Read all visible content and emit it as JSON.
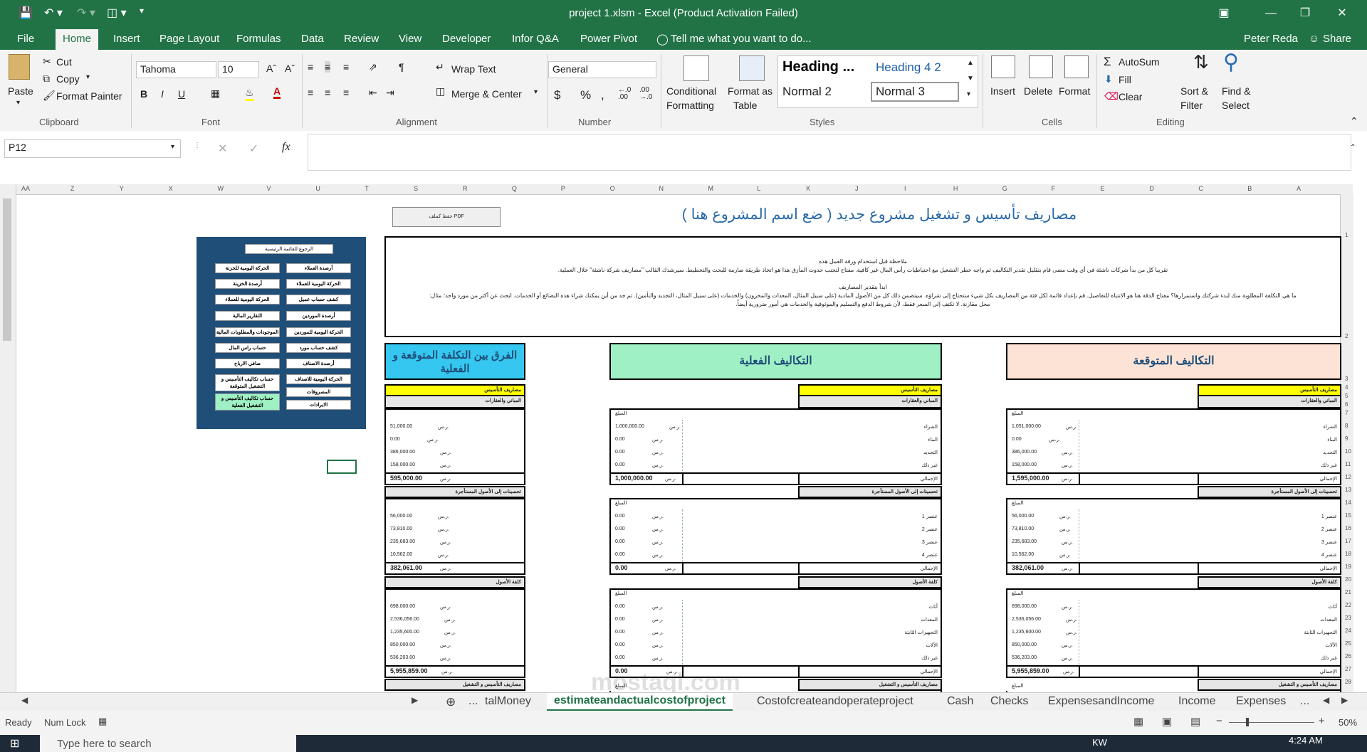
{
  "window": {
    "title": "project 1.xlsm - Excel (Product Activation Failed)",
    "user": "Peter Reda",
    "share": "Share"
  },
  "tabs": [
    "File",
    "Home",
    "Insert",
    "Page Layout",
    "Formulas",
    "Data",
    "Review",
    "View",
    "Developer",
    "Infor Q&A",
    "Power Pivot"
  ],
  "tell_me": "Tell me what you want to do...",
  "ribbon": {
    "clipboard": {
      "paste": "Paste",
      "cut": "Cut",
      "copy": "Copy",
      "format_painter": "Format Painter",
      "label": "Clipboard"
    },
    "font": {
      "name": "Tahoma",
      "size": "10",
      "label": "Font",
      "bold": "B",
      "italic": "I",
      "underline": "U"
    },
    "alignment": {
      "wrap": "Wrap Text",
      "merge": "Merge & Center",
      "label": "Alignment"
    },
    "number": {
      "format": "General",
      "label": "Number",
      "currency": "$",
      "percent": "%",
      "comma": ","
    },
    "styles": {
      "conditional": "Conditional",
      "conditional2": "Formatting",
      "format_as": "Format as",
      "format_as2": "Table",
      "heading": "Heading ...",
      "heading42": "Heading 4 2",
      "normal2": "Normal 2",
      "normal3": "Normal 3",
      "label": "Styles"
    },
    "cells": {
      "insert": "Insert",
      "delete": "Delete",
      "format": "Format",
      "label": "Cells"
    },
    "editing": {
      "autosum": "AutoSum",
      "fill": "Fill",
      "clear": "Clear",
      "sort": "Sort &",
      "sort2": "Filter",
      "find": "Find &",
      "find2": "Select",
      "label": "Editing"
    }
  },
  "formula_bar": {
    "name_box": "P12",
    "value": "",
    "fx": "fx"
  },
  "columns": [
    "AA",
    "Z",
    "Y",
    "X",
    "W",
    "V",
    "U",
    "T",
    "S",
    "R",
    "Q",
    "P",
    "O",
    "N",
    "M",
    "L",
    "K",
    "J",
    "I",
    "H",
    "G",
    "F",
    "E",
    "D",
    "C",
    "B",
    "A"
  ],
  "rows": [
    "1",
    "2",
    "3",
    "4",
    "5",
    "6",
    "7",
    "8",
    "9",
    "10",
    "11",
    "12",
    "13",
    "14",
    "15",
    "16",
    "17",
    "18",
    "19",
    "20",
    "21",
    "22",
    "23",
    "24",
    "25",
    "26",
    "27",
    "28"
  ],
  "sheet": {
    "pdf_button": "حفظ كملف PDF",
    "title": "مصاريف تأسيس و تشغيل مشروع جديد ( ضع اسم المشروع هنا )",
    "note_title": "ملاحظة قبل استخدام ورقة العمل هذه",
    "note_line1": "تقريبا كل من بدأ شركات ناشئة في أي وقت مضى قام بتقليل تقدير التكاليف ثم واجه خطر التشغيل مع احتياطيات رأس المال غير كافية. مفتاح لتجنب حدوث المأزق هذا هو اتخاذ طريقة صارمة للبحث والتخطيط. سيرشدك القالب \"مصاريف شركة ناشئة\" خلال العملية.",
    "note_title2": "ابدأ بتقدير المصاريف",
    "note_line2": "ما هي التكلفة المطلوبة منك لبدء شركتك واستمرارها؟ مفتاح الدقة هنا هو الانتباه للتفاصيل. قم بإعداد قائمة لكل فئة من المصاريف بكل شيء ستحتاج إلى شراؤه. سيتضمن ذلك كل من الأصول المادية (على سبيل المثال، المعدات والمخزون) والخدمات (على سبيل المثال، التجديد والتأمين). ثم جد من أين يمكنك شراء هذه البضائع أو الخدمات. ابحث عن أكثر من مورد واحد؛ مثال:",
    "note_line3": "محل مقارنة. لا تكتف إلى السعر فقط، لأن شروط الدفع والتسليم والموثوقية والخدمات هي أمور ضرورية أيضاً.",
    "hdr_expected": "التكاليف المتوقعة",
    "hdr_actual": "التكاليف الفعلية",
    "hdr_diff": "الفرق بين التكلفة المتوقعة و الفعلية",
    "nav": {
      "back": "الرجوع للقائمة الرئيسية",
      "left": [
        "الحركة اليومية للخزنة والمصروف",
        "أرصدة الخزينة",
        "الحركة اليومية للعملاء",
        "التقارير المالية",
        "الموجودات والمطلوبات المالية",
        "حساب راس المال",
        "صافي الارباح",
        "حساب تكاليف التأسيس و التشغيل المتوقعة",
        "حساب تكاليف التأسيس و التشغيل الفعلية"
      ],
      "right": [
        "أرصدة العملاء",
        "الحركة اليومية للعملاء",
        "كشف حساب عميل",
        "أرصدة الموردين",
        "الحركة اليومية للموردين",
        "كشف حساب مورد",
        "أرصدة الاصناف",
        "الحركة اليومية للاصناف",
        "المصروفات",
        "الايرادات"
      ]
    },
    "labels": {
      "setup": "مصاريف التأسيس",
      "buildings": "المباني والعقارات",
      "amount": "المبلغ",
      "total": "الإجمالي",
      "improvements": "تحسينات إلى الأصول المستأجرة",
      "assets": "كلفة الأصول",
      "setup_ops": "مصاريف التأسيس و التشغيل",
      "cur": "ر.س."
    },
    "b1_rows": [
      "الشراء",
      "البناء",
      "التجديد",
      "غير ذلك"
    ],
    "b2_rows": [
      "عنصر 1",
      "عنصر 2",
      "عنصر 3",
      "عنصر 4"
    ],
    "b3_rows": [
      "أثاث",
      "المعدات",
      "التجهيزات الثابتة",
      "الآلات",
      "غير ذلك"
    ],
    "expected": {
      "b1": [
        "1,051,000.00",
        "0.00",
        "386,000.00",
        "158,000.00"
      ],
      "b1_total": "1,595,000.00",
      "b2": [
        "56,000.00",
        "73,810.00",
        "235,683.00",
        "10,562.00"
      ],
      "b2_total": "382,061.00",
      "b3": [
        "698,000.00",
        "2,536,056.00",
        "1,235,600.00",
        "850,000.00",
        "536,203.00"
      ],
      "b3_total": "5,955,859.00"
    },
    "actual": {
      "b1": [
        "1,000,000.00",
        "0.00",
        "0.00",
        "0.00"
      ],
      "b1_total": "1,000,000.00",
      "b2": [
        "0.00",
        "0.00",
        "0.00",
        "0.00"
      ],
      "b2_total": "0.00",
      "b3": [
        "0.00",
        "0.00",
        "0.00",
        "0.00",
        "0.00"
      ],
      "b3_total": "0.00"
    },
    "diff": {
      "b1": [
        "51,000.00",
        "0.00",
        "386,000.00",
        "158,000.00"
      ],
      "b1_total": "595,000.00",
      "b2": [
        "56,000.00",
        "73,810.00",
        "235,683.00",
        "10,562.00"
      ],
      "b2_total": "382,061.00",
      "b3": [
        "698,000.00",
        "2,536,056.00",
        "1,235,600.00",
        "850,000.00",
        "536,203.00"
      ],
      "b3_total": "5,955,859.00"
    }
  },
  "sheet_tabs": [
    "...",
    "talMoney",
    "estimateandactualcostofproject",
    "Costofcreateandoperateproject",
    "Cash",
    "Checks",
    "ExpensesandIncome",
    "Income",
    "Expenses",
    "..."
  ],
  "active_sheet": "estimateandactualcostofproject",
  "status": {
    "ready": "Ready",
    "numlock": "Num Lock",
    "zoom": "50%"
  },
  "taskbar": {
    "search": "Type here to search",
    "time": "4:24 AM",
    "lang": "KW"
  },
  "watermark": "mostaql.com"
}
